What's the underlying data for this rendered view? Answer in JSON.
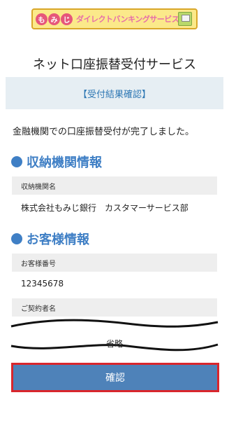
{
  "logo": {
    "char1": "も",
    "char2": "み",
    "char3": "じ",
    "service_text": "ダイレクトバンキングサービス"
  },
  "page_title": "ネット口座振替受付サービス",
  "result_bar_text": "【受付結果確認】",
  "complete_message": "金融機関での口座振替受付が完了しました。",
  "sections": {
    "institution": {
      "heading": "収納機関情報",
      "label": "収納機関名",
      "value": "株式会社もみじ銀行　カスタマーサービス部"
    },
    "customer": {
      "heading": "お客様情報",
      "number_label": "お客様番号",
      "number_value": "12345678",
      "contractor_label": "ご契約者名"
    }
  },
  "omitted_text": "省略",
  "confirm_button": "確認",
  "colors": {
    "accent": "#3f7fc5",
    "button": "#4e82b9",
    "highlight_outline": "#d9262c",
    "result_bar_bg": "#e6eef3"
  }
}
